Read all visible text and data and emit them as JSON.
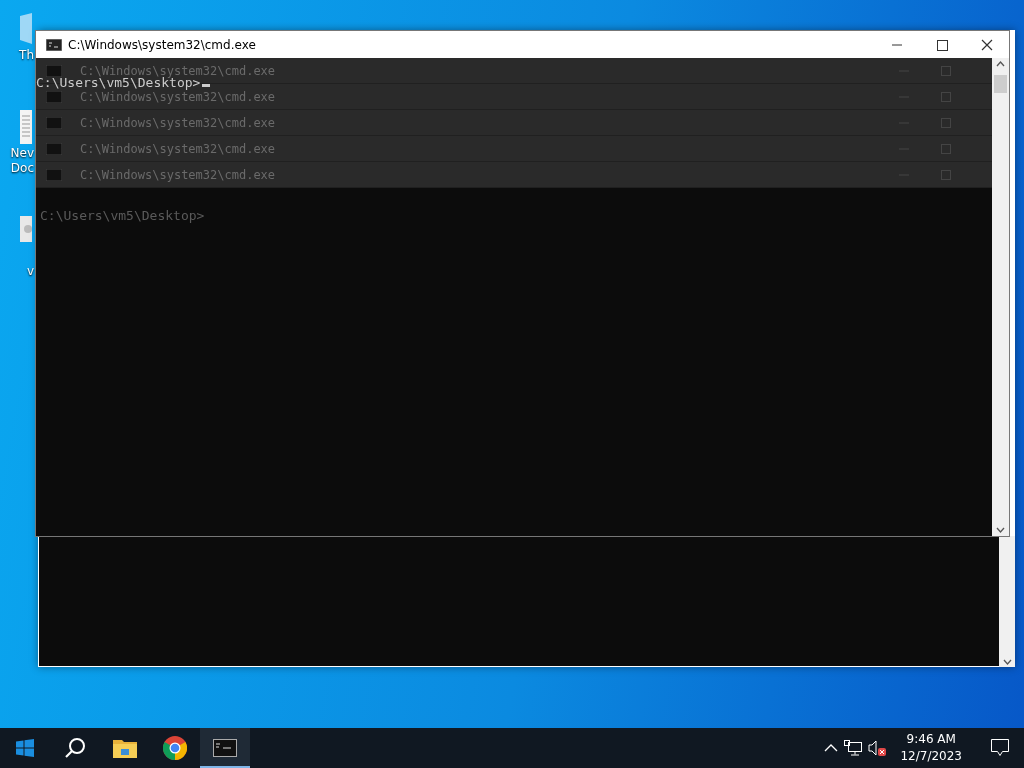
{
  "desktop_icons": [
    {
      "kind": "pc",
      "lines": [
        "Th"
      ]
    },
    {
      "kind": "document",
      "lines": [
        "Nev",
        "Doc"
      ]
    },
    {
      "kind": "app",
      "lines": [
        "v"
      ]
    }
  ],
  "back_window": {
    "kind": "console"
  },
  "window": {
    "title": "C:\\Windows\\system32\\cmd.exe",
    "ghost_rows": [
      {
        "title": "C:\\Windows\\system32\\cmd.exe"
      },
      {
        "title": "C:\\Windows\\system32\\cmd.exe"
      },
      {
        "title": "C:\\Windows\\system32\\cmd.exe"
      },
      {
        "title": "C:\\Windows\\system32\\cmd.exe"
      },
      {
        "title": "C:\\Windows\\system32\\cmd.exe"
      }
    ],
    "prompt": "C:\\Users\\vm5\\Desktop>",
    "cursor": true,
    "ghost_prompt": "C:\\Users\\vm5\\Desktop>"
  },
  "taskbar": {
    "apps": [
      {
        "kind": "start",
        "active": false
      },
      {
        "kind": "search",
        "active": false
      },
      {
        "kind": "folder",
        "active": false
      },
      {
        "kind": "browser",
        "active": false
      },
      {
        "kind": "console",
        "active": true
      }
    ],
    "tray": {
      "time": "9:46 AM",
      "date": "12/7/2023"
    }
  }
}
